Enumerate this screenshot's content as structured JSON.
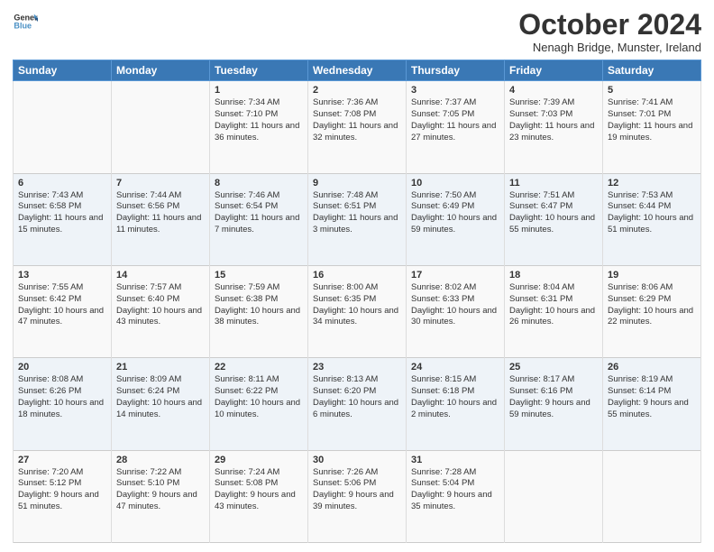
{
  "header": {
    "logo_line1": "General",
    "logo_line2": "Blue",
    "month": "October 2024",
    "location": "Nenagh Bridge, Munster, Ireland"
  },
  "days_of_week": [
    "Sunday",
    "Monday",
    "Tuesday",
    "Wednesday",
    "Thursday",
    "Friday",
    "Saturday"
  ],
  "weeks": [
    [
      {
        "day": "",
        "info": ""
      },
      {
        "day": "",
        "info": ""
      },
      {
        "day": "1",
        "info": "Sunrise: 7:34 AM\nSunset: 7:10 PM\nDaylight: 11 hours\nand 36 minutes."
      },
      {
        "day": "2",
        "info": "Sunrise: 7:36 AM\nSunset: 7:08 PM\nDaylight: 11 hours\nand 32 minutes."
      },
      {
        "day": "3",
        "info": "Sunrise: 7:37 AM\nSunset: 7:05 PM\nDaylight: 11 hours\nand 27 minutes."
      },
      {
        "day": "4",
        "info": "Sunrise: 7:39 AM\nSunset: 7:03 PM\nDaylight: 11 hours\nand 23 minutes."
      },
      {
        "day": "5",
        "info": "Sunrise: 7:41 AM\nSunset: 7:01 PM\nDaylight: 11 hours\nand 19 minutes."
      }
    ],
    [
      {
        "day": "6",
        "info": "Sunrise: 7:43 AM\nSunset: 6:58 PM\nDaylight: 11 hours\nand 15 minutes."
      },
      {
        "day": "7",
        "info": "Sunrise: 7:44 AM\nSunset: 6:56 PM\nDaylight: 11 hours\nand 11 minutes."
      },
      {
        "day": "8",
        "info": "Sunrise: 7:46 AM\nSunset: 6:54 PM\nDaylight: 11 hours\nand 7 minutes."
      },
      {
        "day": "9",
        "info": "Sunrise: 7:48 AM\nSunset: 6:51 PM\nDaylight: 11 hours\nand 3 minutes."
      },
      {
        "day": "10",
        "info": "Sunrise: 7:50 AM\nSunset: 6:49 PM\nDaylight: 10 hours\nand 59 minutes."
      },
      {
        "day": "11",
        "info": "Sunrise: 7:51 AM\nSunset: 6:47 PM\nDaylight: 10 hours\nand 55 minutes."
      },
      {
        "day": "12",
        "info": "Sunrise: 7:53 AM\nSunset: 6:44 PM\nDaylight: 10 hours\nand 51 minutes."
      }
    ],
    [
      {
        "day": "13",
        "info": "Sunrise: 7:55 AM\nSunset: 6:42 PM\nDaylight: 10 hours\nand 47 minutes."
      },
      {
        "day": "14",
        "info": "Sunrise: 7:57 AM\nSunset: 6:40 PM\nDaylight: 10 hours\nand 43 minutes."
      },
      {
        "day": "15",
        "info": "Sunrise: 7:59 AM\nSunset: 6:38 PM\nDaylight: 10 hours\nand 38 minutes."
      },
      {
        "day": "16",
        "info": "Sunrise: 8:00 AM\nSunset: 6:35 PM\nDaylight: 10 hours\nand 34 minutes."
      },
      {
        "day": "17",
        "info": "Sunrise: 8:02 AM\nSunset: 6:33 PM\nDaylight: 10 hours\nand 30 minutes."
      },
      {
        "day": "18",
        "info": "Sunrise: 8:04 AM\nSunset: 6:31 PM\nDaylight: 10 hours\nand 26 minutes."
      },
      {
        "day": "19",
        "info": "Sunrise: 8:06 AM\nSunset: 6:29 PM\nDaylight: 10 hours\nand 22 minutes."
      }
    ],
    [
      {
        "day": "20",
        "info": "Sunrise: 8:08 AM\nSunset: 6:26 PM\nDaylight: 10 hours\nand 18 minutes."
      },
      {
        "day": "21",
        "info": "Sunrise: 8:09 AM\nSunset: 6:24 PM\nDaylight: 10 hours\nand 14 minutes."
      },
      {
        "day": "22",
        "info": "Sunrise: 8:11 AM\nSunset: 6:22 PM\nDaylight: 10 hours\nand 10 minutes."
      },
      {
        "day": "23",
        "info": "Sunrise: 8:13 AM\nSunset: 6:20 PM\nDaylight: 10 hours\nand 6 minutes."
      },
      {
        "day": "24",
        "info": "Sunrise: 8:15 AM\nSunset: 6:18 PM\nDaylight: 10 hours\nand 2 minutes."
      },
      {
        "day": "25",
        "info": "Sunrise: 8:17 AM\nSunset: 6:16 PM\nDaylight: 9 hours\nand 59 minutes."
      },
      {
        "day": "26",
        "info": "Sunrise: 8:19 AM\nSunset: 6:14 PM\nDaylight: 9 hours\nand 55 minutes."
      }
    ],
    [
      {
        "day": "27",
        "info": "Sunrise: 7:20 AM\nSunset: 5:12 PM\nDaylight: 9 hours\nand 51 minutes."
      },
      {
        "day": "28",
        "info": "Sunrise: 7:22 AM\nSunset: 5:10 PM\nDaylight: 9 hours\nand 47 minutes."
      },
      {
        "day": "29",
        "info": "Sunrise: 7:24 AM\nSunset: 5:08 PM\nDaylight: 9 hours\nand 43 minutes."
      },
      {
        "day": "30",
        "info": "Sunrise: 7:26 AM\nSunset: 5:06 PM\nDaylight: 9 hours\nand 39 minutes."
      },
      {
        "day": "31",
        "info": "Sunrise: 7:28 AM\nSunset: 5:04 PM\nDaylight: 9 hours\nand 35 minutes."
      },
      {
        "day": "",
        "info": ""
      },
      {
        "day": "",
        "info": ""
      }
    ]
  ]
}
